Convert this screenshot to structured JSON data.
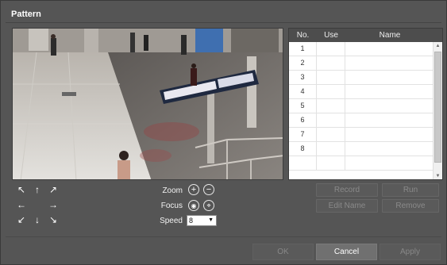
{
  "dialog": {
    "title": "Pattern"
  },
  "table": {
    "headers": {
      "no": "No.",
      "use": "Use",
      "name": "Name"
    },
    "rows": [
      {
        "no": "1",
        "use": "",
        "name": ""
      },
      {
        "no": "2",
        "use": "",
        "name": ""
      },
      {
        "no": "3",
        "use": "",
        "name": ""
      },
      {
        "no": "4",
        "use": "",
        "name": ""
      },
      {
        "no": "5",
        "use": "",
        "name": ""
      },
      {
        "no": "6",
        "use": "",
        "name": ""
      },
      {
        "no": "7",
        "use": "",
        "name": ""
      },
      {
        "no": "8",
        "use": "",
        "name": ""
      },
      {
        "no": "",
        "use": "",
        "name": ""
      }
    ]
  },
  "ptz": {
    "zoom_label": "Zoom",
    "focus_label": "Focus",
    "speed_label": "Speed",
    "speed_value": "8"
  },
  "actions": {
    "record": "Record",
    "run": "Run",
    "edit_name": "Edit Name",
    "remove": "Remove"
  },
  "footer": {
    "ok": "OK",
    "cancel": "Cancel",
    "apply": "Apply"
  }
}
